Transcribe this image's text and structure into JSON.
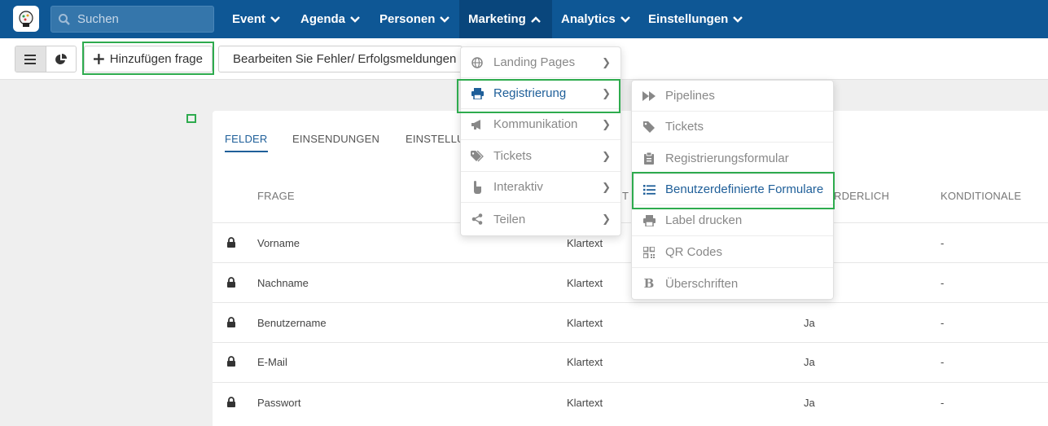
{
  "search": {
    "placeholder": "Suchen"
  },
  "nav": {
    "items": [
      {
        "label": "Event"
      },
      {
        "label": "Agenda"
      },
      {
        "label": "Personen"
      },
      {
        "label": "Marketing"
      },
      {
        "label": "Analytics"
      },
      {
        "label": "Einstellungen"
      }
    ]
  },
  "toolbar": {
    "add_label": "Hinzufügen frage",
    "edit_label": "Bearbeiten Sie Fehler/ Erfolgsmeldungen"
  },
  "tabs": [
    "FELDER",
    "EINSENDUNGEN",
    "EINSTELLU"
  ],
  "columns": {
    "question": "FRAGE",
    "type_fragment": "T",
    "required_fragment": "RDERLICH",
    "conditional": "KONDITIONALE"
  },
  "rows": [
    {
      "question": "Vorname",
      "type": "Klartext",
      "required": "",
      "conditional": "-"
    },
    {
      "question": "Nachname",
      "type": "Klartext",
      "required": "",
      "conditional": "-"
    },
    {
      "question": "Benutzername",
      "type": "Klartext",
      "required": "Ja",
      "conditional": "-"
    },
    {
      "question": "E-Mail",
      "type": "Klartext",
      "required": "Ja",
      "conditional": "-"
    },
    {
      "question": "Passwort",
      "type": "Klartext",
      "required": "Ja",
      "conditional": "-"
    }
  ],
  "marketing_menu": {
    "items": [
      {
        "label": "Landing Pages",
        "icon": "globe-icon"
      },
      {
        "label": "Registrierung",
        "icon": "print-icon"
      },
      {
        "label": "Kommunikation",
        "icon": "megaphone-icon"
      },
      {
        "label": "Tickets",
        "icon": "tags-icon"
      },
      {
        "label": "Interaktiv",
        "icon": "pointer-icon"
      },
      {
        "label": "Teilen",
        "icon": "share-icon"
      }
    ]
  },
  "registration_menu": {
    "items": [
      {
        "label": "Pipelines",
        "icon": "fast-forward-icon"
      },
      {
        "label": "Tickets",
        "icon": "tag-icon"
      },
      {
        "label": "Registrierungsformular",
        "icon": "clipboard-icon"
      },
      {
        "label": "Benutzerdefinierte Formulare",
        "icon": "list-icon"
      },
      {
        "label": "Label drucken",
        "icon": "print-icon"
      },
      {
        "label": "QR Codes",
        "icon": "qrcode-icon"
      },
      {
        "label": "Überschriften",
        "icon": "bold-icon"
      }
    ]
  },
  "colors": {
    "topbar": "#0e5795",
    "accent": "#1f5f99",
    "highlight": "#2eab4e"
  }
}
